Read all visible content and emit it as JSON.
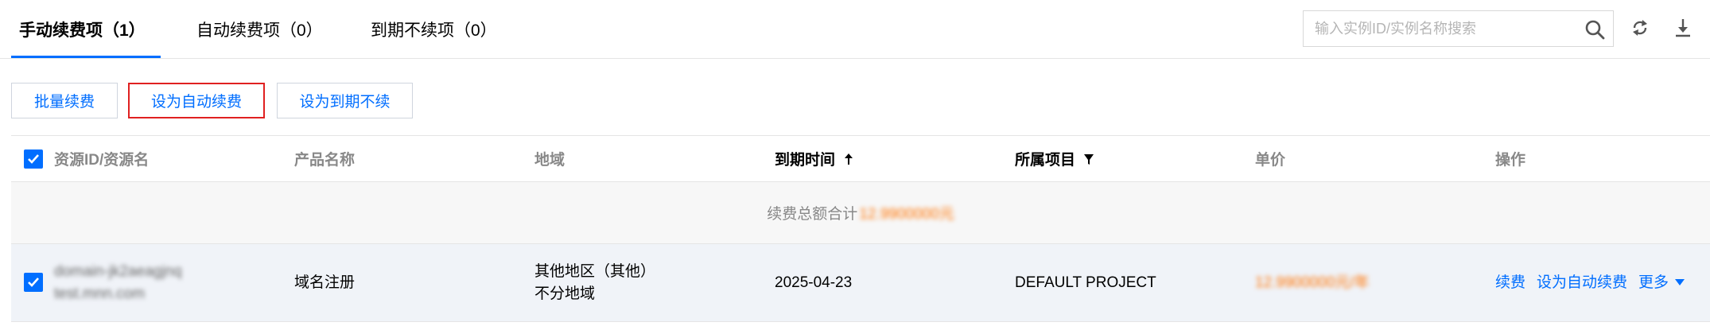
{
  "tabs": [
    {
      "label": "手动续费项（1）",
      "active": true
    },
    {
      "label": "自动续费项（0）",
      "active": false
    },
    {
      "label": "到期不续项（0）",
      "active": false
    }
  ],
  "search": {
    "placeholder": "输入实例ID/实例名称搜索",
    "value": ""
  },
  "toolbar_icons": [
    "search-icon",
    "refresh-icon",
    "download-icon"
  ],
  "actions": {
    "batch_renew": "批量续费",
    "set_auto_renew": "设为自动续费",
    "set_no_renew": "设为到期不续"
  },
  "table": {
    "columns": {
      "resource": "资源ID/资源名",
      "product": "产品名称",
      "region": "地域",
      "expiry": "到期时间",
      "project": "所属项目",
      "price": "单价",
      "operations": "操作"
    },
    "summary": {
      "label": "续费总额合计",
      "amount": "12.9900000元"
    },
    "rows": [
      {
        "checked": true,
        "resource_id": "domain-jk2aeagjnq",
        "resource_name": "test.mnn.com",
        "product": "域名注册",
        "region_line1": "其他地区（其他）",
        "region_line2": "不分地域",
        "expiry": "2025-04-23",
        "project": "DEFAULT PROJECT",
        "price": "12.9900000元/年",
        "op_renew": "续费",
        "op_auto": "设为自动续费",
        "op_more": "更多"
      }
    ]
  },
  "colors": {
    "accent": "#006eff",
    "price": "#ff7200",
    "highlight_border": "#e02020"
  }
}
